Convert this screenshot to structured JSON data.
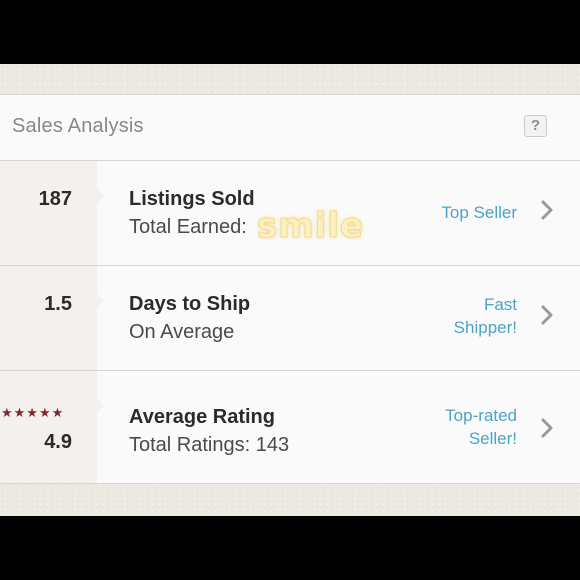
{
  "header": {
    "title": "Sales Analysis",
    "help_label": "?"
  },
  "rows": [
    {
      "stat": "187",
      "title": "Listings Sold",
      "subtitle": "Total Earned:",
      "badge": "Top Seller"
    },
    {
      "stat": "1.5",
      "title": "Days to Ship",
      "subtitle": "On Average",
      "badge_line1": "Fast",
      "badge_line2": "Shipper!"
    },
    {
      "stat": "4.9",
      "stars": "★★★★★",
      "star_rating": 5,
      "title": "Average Rating",
      "subtitle": "Total Ratings: 143",
      "badge_line1": "Top-rated",
      "badge_line2": "Seller!"
    }
  ],
  "sticker_text": "smile",
  "colors": {
    "badge": "#4aa3c8",
    "stars": "#7e2832",
    "stat_background": "#f3f0ed"
  },
  "icons": {
    "help": "question-mark-icon",
    "chevron": "chevron-right-icon",
    "star": "star-icon"
  }
}
